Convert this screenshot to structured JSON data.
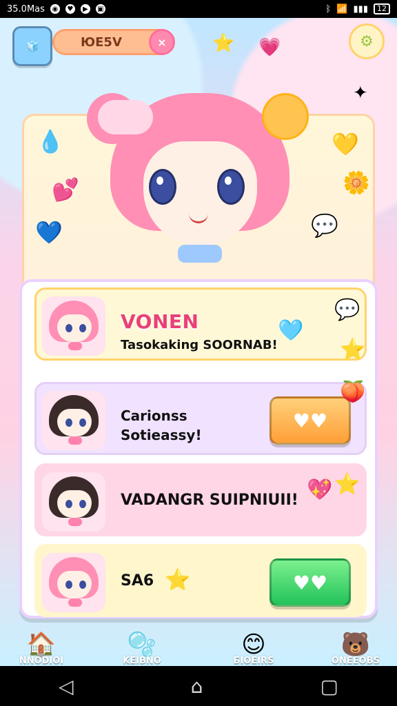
{
  "status_bar": {
    "time": "35.0Mas",
    "battery": "12"
  },
  "top_bar": {
    "title": "ЮЕ5V"
  },
  "list": {
    "items": [
      {
        "title": "VONEN",
        "subtitle": "Tasokaking SOORNAB!"
      },
      {
        "line1": "Carionss",
        "line2": "Sotieassy!"
      },
      {
        "title": "VADANGR SUIPNIUII!"
      },
      {
        "title": "SA6"
      }
    ]
  },
  "bottom_nav": {
    "items": [
      {
        "label": "NNODIOI"
      },
      {
        "label": "KEIBNO"
      },
      {
        "label": "БIOEIRS"
      },
      {
        "label": "ONEEOBS"
      }
    ]
  },
  "colors": {
    "pink": "#ff8fb4",
    "yellow": "#ffd36b",
    "orange": "#ff9f38",
    "green": "#22c35a",
    "lavender": "#f1e2ff"
  },
  "icons": {
    "home": "home-icon",
    "blob": "blob-icon",
    "smile": "smile-icon",
    "bear": "bear-icon",
    "gear": "gear-icon",
    "heart": "heart-icon"
  }
}
